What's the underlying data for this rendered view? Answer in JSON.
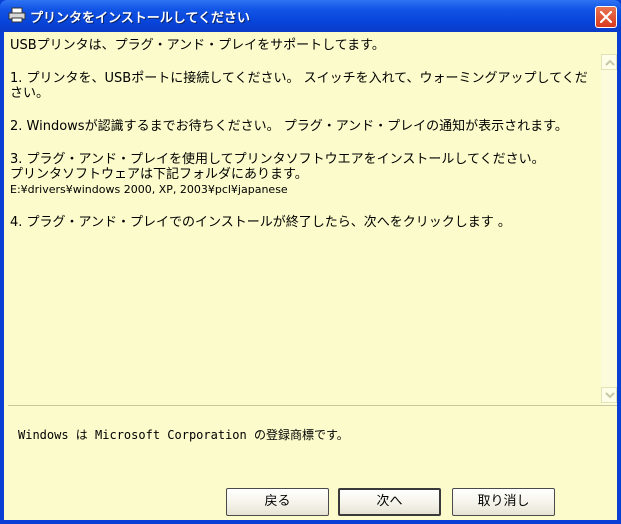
{
  "window": {
    "title": "プリンタをインストールしてください"
  },
  "content": {
    "intro": "USBプリンタは、プラグ・アンド・プレイをサポートしてます。",
    "step1": "1. プリンタを、USBポートに接続してください。 スイッチを入れて、ウォーミングアップしてください。",
    "step2": "2. Windowsが認識するまでお待ちください。 プラグ・アンド・プレイの通知が表示されます。",
    "step3_line1": "3. プラグ・アンド・プレイを使用してプリンタソフトウエアをインストールしてください。",
    "step3_line2": "プリンタソフトウェアは下記フォルダにあります。",
    "step3_path": "E:¥drivers¥windows 2000, XP, 2003¥pcl¥japanese",
    "step4": "4. プラグ・アンド・プレイでのインストールが終了したら、次へをクリックします 。"
  },
  "footer": {
    "trademark": "Windows は Microsoft Corporation の登録商標です。"
  },
  "buttons": {
    "back": "戻る",
    "next": "次へ",
    "cancel": "取り消し"
  },
  "colors": {
    "titlebar": "#0844d9",
    "content_background": "#fbfbcb",
    "close_button": "#d9381e"
  },
  "icons": {
    "title": "printer-icon",
    "close": "close-icon",
    "scroll_up": "scroll-up-arrow-icon",
    "scroll_down": "scroll-down-arrow-icon"
  }
}
